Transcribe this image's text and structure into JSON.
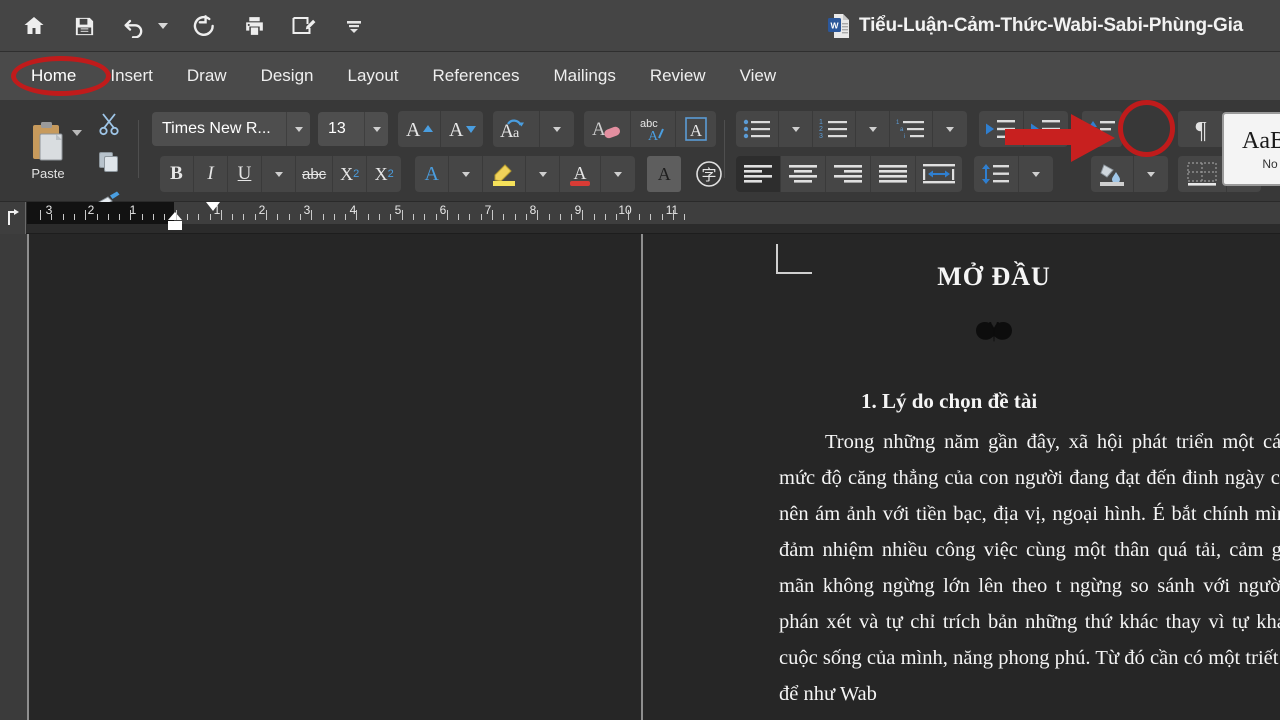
{
  "window": {
    "doc_title": "Tiểu-Luận-Cảm-Thức-Wabi-Sabi-Phùng-Gia",
    "app_icon": "word-document-icon"
  },
  "quick_access": [
    {
      "name": "home-icon",
      "label": "Home"
    },
    {
      "name": "save-icon",
      "label": "Save"
    },
    {
      "name": "undo-icon",
      "label": "Undo"
    },
    {
      "name": "redo-icon",
      "label": "Redo"
    },
    {
      "name": "print-icon",
      "label": "Print"
    },
    {
      "name": "track-changes-icon",
      "label": "Track Changes"
    },
    {
      "name": "customize-toolbar-icon",
      "label": "Customize"
    }
  ],
  "tabs": [
    {
      "label": "Home",
      "active": true
    },
    {
      "label": "Insert",
      "active": false
    },
    {
      "label": "Draw",
      "active": false
    },
    {
      "label": "Design",
      "active": false
    },
    {
      "label": "Layout",
      "active": false
    },
    {
      "label": "References",
      "active": false
    },
    {
      "label": "Mailings",
      "active": false
    },
    {
      "label": "Review",
      "active": false
    },
    {
      "label": "View",
      "active": false
    }
  ],
  "ribbon": {
    "clipboard": {
      "paste_label": "Paste",
      "cut_label": "Cut",
      "copy_label": "Copy",
      "format_painter_label": "Format Painter"
    },
    "font": {
      "font_name": "Times New R...",
      "font_name_full": "Times New Roman",
      "font_size": "13",
      "grow_font_label": "Grow Font",
      "shrink_font_label": "Shrink Font",
      "change_case_label": "Change Case",
      "clear_formatting_label": "Clear All Formatting",
      "spelling_label": "abc",
      "text_effects_label": "Text Effects",
      "bold_label": "B",
      "italic_label": "I",
      "underline_label": "U",
      "strikethrough_label": "abc",
      "subscript_label": "X",
      "subscript_sub": "2",
      "superscript_label": "X",
      "superscript_sup": "2",
      "font_color_label": "A",
      "highlight_label": "Text Highlight Color",
      "text_color_label": "A",
      "char_shading_label": "A",
      "asian_layout_label": "字"
    },
    "paragraph": {
      "bullets_label": "Bullets",
      "numbering_label": "Numbering",
      "multilevel_label": "Multilevel List",
      "decrease_indent_label": "Decrease Indent",
      "increase_indent_label": "Increase Indent",
      "sort_label": "Sort",
      "show_marks_label": "Show/Hide Paragraph Marks",
      "align_left_label": "Align Left",
      "align_center_label": "Center",
      "align_right_label": "Align Right",
      "justify_label": "Justify",
      "line_spacing_label": "Line Spacing",
      "spacing_before_after_label": "Paragraph Spacing",
      "shading_label": "Shading",
      "borders_label": "Borders"
    },
    "styles": {
      "preview_text": "AaBb",
      "style_name": "No"
    }
  },
  "annotations": {
    "home_circle_color": "#c01b1b",
    "arrow_color": "#c8201f",
    "pilcrow_circle_color": "#c01b1b",
    "arrow_target": "show-marks-button"
  },
  "ruler": {
    "margin_numbers": [
      "3",
      "2",
      "1"
    ],
    "page_numbers": [
      "1",
      "2",
      "3",
      "4",
      "5",
      "6",
      "7",
      "8",
      "9",
      "10",
      "11"
    ],
    "tab_selector": "left-tab-stop"
  },
  "document": {
    "heading": "MỞ ĐẦU",
    "ornament": "butterfly-ornament",
    "section_heading": "1. Lý do chọn đề tài",
    "paragraphs": [
      "Trong những năm gần đây, xã hội phát triển một cách cho mức độ căng thẳng của con người đang đạt đến đinh ngày càng trở nên ám ảnh với tiền bạc, địa vị, ngoại hình. É bắt chính mình phải đảm nhiệm nhiều công việc cùng một thân quá tải, cảm giác bất mãn không ngừng lớn lên theo t ngừng so sánh với người khác, phán xét và tự chỉ trích bản những thứ khác thay vì tự khám phá cuộc sống của mình, năng phong phú. Từ đó cần có một triết lí sống để như Wab"
    ],
    "lines": [
      "Trong những năm gần đây, xã hội phát triển một cách",
      "cho mức độ căng thẳng của con người đang đạt đến đinh",
      "ngày càng trở nên ám ảnh với tiền bạc, địa vị, ngoại hình. É",
      "bắt chính mình phải đảm nhiệm nhiều công việc cùng một",
      "thân quá tải, cảm giác bất mãn không ngừng lớn lên theo t",
      "ngừng so sánh với người khác, phán xét và tự chỉ trích bản",
      "những thứ khác thay vì tự khám phá cuộc sống của mình,",
      "năng phong phú. Từ đó cần có một triết lí sống để như Wab"
    ]
  },
  "colors": {
    "titlebar_bg": "#454545",
    "tabstrip_bg": "#4a4a4a",
    "ribbon_bg": "#383838",
    "ruler_bg": "#2b2b2b",
    "page_bg": "#262626",
    "accent_blue": "#4a9ee0"
  }
}
